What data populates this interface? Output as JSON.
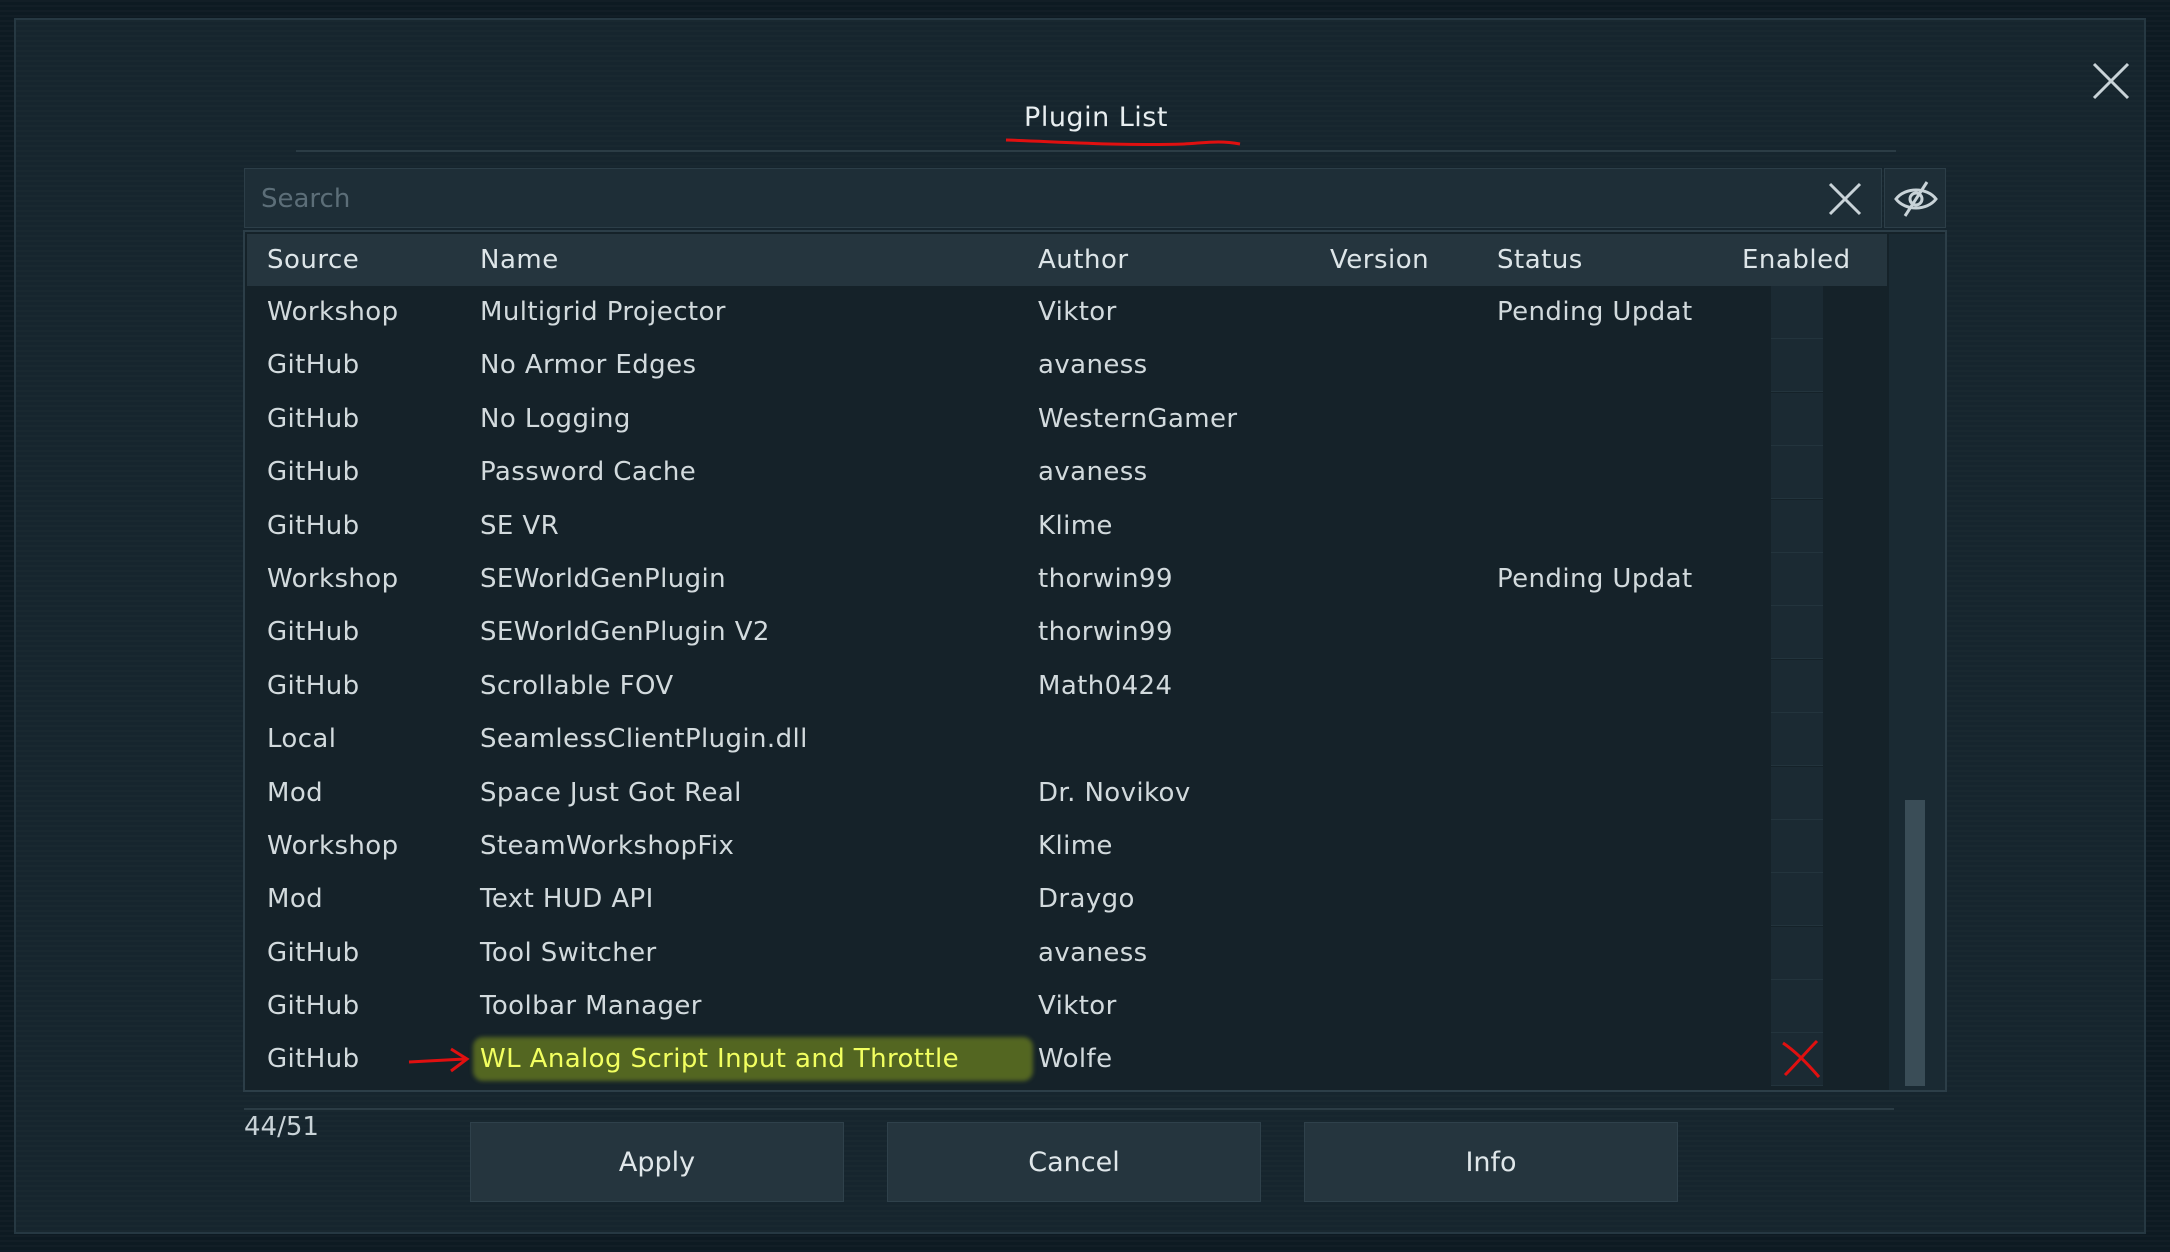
{
  "dialog": {
    "title": "Plugin List",
    "close_icon": "close-icon"
  },
  "search": {
    "placeholder": "Search",
    "value": "",
    "clear_icon": "close-icon",
    "visibility_icon": "eye-off-icon"
  },
  "table": {
    "columns": {
      "source": "Source",
      "name": "Name",
      "author": "Author",
      "version": "Version",
      "status": "Status",
      "enabled": "Enabled"
    },
    "rows": [
      {
        "source": "Workshop",
        "name": "Multigrid Projector",
        "author": "Viktor",
        "version": "",
        "status": "Pending Updat",
        "enabled": false
      },
      {
        "source": "GitHub",
        "name": "No Armor Edges",
        "author": "avaness",
        "version": "",
        "status": "",
        "enabled": false
      },
      {
        "source": "GitHub",
        "name": "No Logging",
        "author": "WesternGamer",
        "version": "",
        "status": "",
        "enabled": false
      },
      {
        "source": "GitHub",
        "name": "Password Cache",
        "author": "avaness",
        "version": "",
        "status": "",
        "enabled": false
      },
      {
        "source": "GitHub",
        "name": "SE VR",
        "author": "Klime",
        "version": "",
        "status": "",
        "enabled": false
      },
      {
        "source": "Workshop",
        "name": "SEWorldGenPlugin",
        "author": "thorwin99",
        "version": "",
        "status": "Pending Updat",
        "enabled": false
      },
      {
        "source": "GitHub",
        "name": "SEWorldGenPlugin V2",
        "author": "thorwin99",
        "version": "",
        "status": "",
        "enabled": false
      },
      {
        "source": "GitHub",
        "name": "Scrollable FOV",
        "author": "Math0424",
        "version": "",
        "status": "",
        "enabled": false
      },
      {
        "source": "Local",
        "name": "SeamlessClientPlugin.dll",
        "author": "",
        "version": "",
        "status": "",
        "enabled": false
      },
      {
        "source": "Mod",
        "name": "Space Just Got Real",
        "author": "Dr. Novikov",
        "version": "",
        "status": "",
        "enabled": false
      },
      {
        "source": "Workshop",
        "name": "SteamWorkshopFix",
        "author": "Klime",
        "version": "",
        "status": "",
        "enabled": false
      },
      {
        "source": "Mod",
        "name": "Text HUD API",
        "author": "Draygo",
        "version": "",
        "status": "",
        "enabled": false
      },
      {
        "source": "GitHub",
        "name": "Tool Switcher",
        "author": "avaness",
        "version": "",
        "status": "",
        "enabled": false
      },
      {
        "source": "GitHub",
        "name": "Toolbar Manager",
        "author": "Viktor",
        "version": "",
        "status": "",
        "enabled": false
      },
      {
        "source": "GitHub",
        "name": "WL Analog Script Input and Throttle",
        "author": "Wolfe",
        "version": "",
        "status": "",
        "enabled": false,
        "highlighted": true
      }
    ]
  },
  "scrollbar": {
    "position": 0.66
  },
  "footer": {
    "count": "44/51",
    "apply_label": "Apply",
    "cancel_label": "Cancel",
    "info_label": "Info"
  },
  "annotations": {
    "underline_color": "#e01010",
    "arrow_color": "#e01010",
    "highlight_color": "#c8e614",
    "x_mark_color": "#e01010"
  }
}
